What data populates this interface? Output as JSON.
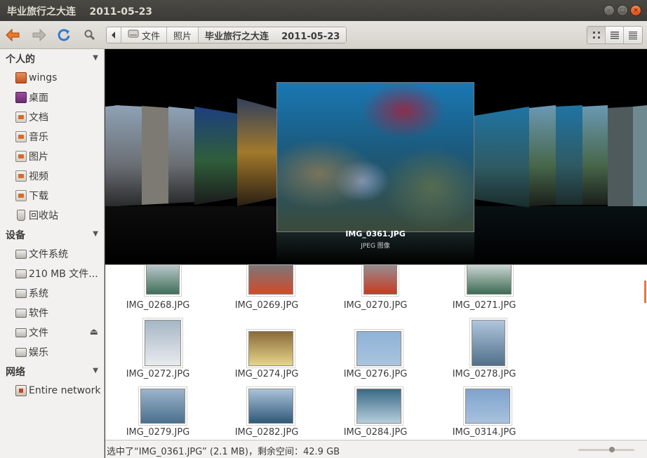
{
  "window": {
    "title": "毕业旅行之大连    2011-05-23",
    "buttons": [
      "minimize",
      "maximize",
      "close"
    ]
  },
  "toolbar": {
    "back_icon": "back-arrow-icon",
    "forward_icon": "forward-arrow-icon",
    "reload_icon": "reload-icon",
    "search_icon": "search-icon",
    "breadcrumbs": [
      {
        "label": "文件"
      },
      {
        "label": "照片"
      },
      {
        "label": "毕业旅行之大连    2011-05-23"
      }
    ],
    "views": [
      "icon-view",
      "list-view",
      "compact-view"
    ]
  },
  "sidebar": {
    "sections": [
      {
        "title": "个人的",
        "items": [
          {
            "label": "wings",
            "icon": "home-folder-icon"
          },
          {
            "label": "桌面",
            "icon": "desktop-icon"
          },
          {
            "label": "文档",
            "icon": "documents-icon"
          },
          {
            "label": "音乐",
            "icon": "music-icon"
          },
          {
            "label": "图片",
            "icon": "pictures-icon"
          },
          {
            "label": "视频",
            "icon": "videos-icon"
          },
          {
            "label": "下载",
            "icon": "downloads-icon"
          },
          {
            "label": "回收站",
            "icon": "trash-icon"
          }
        ]
      },
      {
        "title": "设备",
        "items": [
          {
            "label": "文件系统",
            "icon": "drive-icon"
          },
          {
            "label": "210 MB 文件...",
            "icon": "drive-icon"
          },
          {
            "label": "系统",
            "icon": "drive-icon"
          },
          {
            "label": "软件",
            "icon": "drive-icon"
          },
          {
            "label": "文件",
            "icon": "drive-icon"
          },
          {
            "label": "娱乐",
            "icon": "drive-icon"
          }
        ]
      },
      {
        "title": "网络",
        "items": [
          {
            "label": "Entire network",
            "icon": "network-icon"
          }
        ]
      }
    ]
  },
  "coverflow": {
    "selected_name": "IMG_0361.JPG",
    "selected_type": "JPEG 图像"
  },
  "files": [
    {
      "name": "IMG_0268.JPG",
      "colors": [
        "#cfd6dc",
        "#3f6f5a"
      ]
    },
    {
      "name": "IMG_0269.JPG",
      "colors": [
        "#6f7e86",
        "#d24a2a"
      ]
    },
    {
      "name": "IMG_0270.JPG",
      "colors": [
        "#8e9aa2",
        "#c83a22"
      ]
    },
    {
      "name": "IMG_0271.JPG",
      "colors": [
        "#e3e7ea",
        "#3d6b52"
      ]
    },
    {
      "name": "IMG_0272.JPG",
      "colors": [
        "#a6b6c6",
        "#e8ebee"
      ]
    },
    {
      "name": "IMG_0274.JPG",
      "colors": [
        "#8a6a3a",
        "#e6d58a"
      ]
    },
    {
      "name": "IMG_0276.JPG",
      "colors": [
        "#8fb2d6",
        "#a9c4df"
      ]
    },
    {
      "name": "IMG_0278.JPG",
      "colors": [
        "#b0c6dc",
        "#50708a"
      ]
    },
    {
      "name": "IMG_0279.JPG",
      "colors": [
        "#9bb4cb",
        "#4a6f8d"
      ]
    },
    {
      "name": "IMG_0282.JPG",
      "colors": [
        "#aac3da",
        "#2f5878"
      ]
    },
    {
      "name": "IMG_0284.JPG",
      "colors": [
        "#3a6a86",
        "#b6cedd"
      ]
    },
    {
      "name": "IMG_0314.JPG",
      "colors": [
        "#7fa3cc",
        "#a8c1de"
      ]
    }
  ],
  "status": {
    "text": "选中了“IMG_0361.JPG” (2.1 MB)，剩余空间：42.9 GB",
    "zoom_level": 0.55
  }
}
